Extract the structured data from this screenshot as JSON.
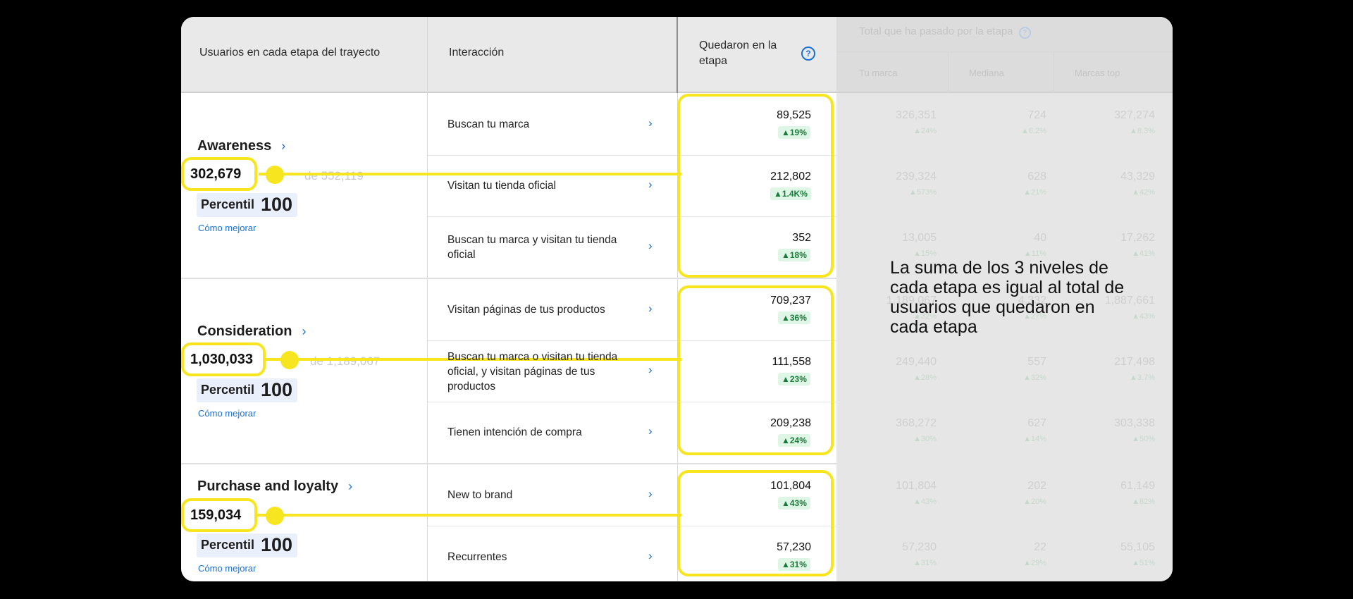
{
  "header": {
    "col1": "Usuarios en cada etapa del trayecto",
    "col2": "Interacción",
    "col3": "Quedaron en la etapa",
    "col4": "Total que ha pasado por la etapa",
    "sub_brand": "Tu marca",
    "sub_median": "Mediana",
    "sub_top": "Marcas top"
  },
  "stages": [
    {
      "name": "Awareness",
      "value": "302,679",
      "faded_share": "de 552,119",
      "percentile_label": "Percentil",
      "percentile": "100",
      "link": "Cómo mejorar"
    },
    {
      "name": "Consideration",
      "value": "1,030,033",
      "faded_share": "de 1,189,067",
      "percentile_label": "Percentil",
      "percentile": "100",
      "link": "Cómo mejorar"
    },
    {
      "name": "Purchase and loyalty",
      "value": "159,034",
      "percentile_label": "Percentil",
      "percentile": "100",
      "link": "Cómo mejorar"
    }
  ],
  "rows": [
    {
      "interaction": "Buscan tu marca",
      "stayed": "89,525",
      "stayed_pct": "▲19%",
      "brand": "326,351",
      "brand_pct": "▲24%",
      "median": "724",
      "median_pct": "▲6.2%",
      "top": "327,274",
      "top_pct": "▲8.3%"
    },
    {
      "interaction": "Visitan tu tienda oficial",
      "stayed": "212,802",
      "stayed_pct": "▲1.4K%",
      "brand": "239,324",
      "brand_pct": "▲573%",
      "median": "628",
      "median_pct": "▲21%",
      "top": "43,329",
      "top_pct": "▲42%"
    },
    {
      "interaction": "Buscan tu marca y visitan tu tienda oficial",
      "stayed": "352",
      "stayed_pct": "▲18%",
      "brand": "13,005",
      "brand_pct": "▲15%",
      "median": "40",
      "median_pct": "▲11%",
      "top": "17,262",
      "top_pct": "▲41%"
    },
    {
      "interaction": "Visitan páginas de tus productos",
      "stayed": "709,237",
      "stayed_pct": "▲36%",
      "brand": "1,189,067",
      "brand_pct": "▲32%",
      "median": "4,332",
      "median_pct": "▲27%",
      "top": "1,887,661",
      "top_pct": "▲43%"
    },
    {
      "interaction": "Buscan tu marca o visitan tu tienda oficial, y visitan páginas de tus productos",
      "stayed": "111,558",
      "stayed_pct": "▲23%",
      "brand": "249,440",
      "brand_pct": "▲28%",
      "median": "557",
      "median_pct": "▲32%",
      "top": "217,498",
      "top_pct": "▲3.7%"
    },
    {
      "interaction": "Tienen intención de compra",
      "stayed": "209,238",
      "stayed_pct": "▲24%",
      "brand": "368,272",
      "brand_pct": "▲30%",
      "median": "627",
      "median_pct": "▲14%",
      "top": "303,338",
      "top_pct": "▲50%"
    },
    {
      "interaction": "New to brand",
      "stayed": "101,804",
      "stayed_pct": "▲43%",
      "brand": "101,804",
      "brand_pct": "▲43%",
      "median": "202",
      "median_pct": "▲20%",
      "top": "61,149",
      "top_pct": "▲82%"
    },
    {
      "interaction": "Recurrentes",
      "stayed": "57,230",
      "stayed_pct": "▲31%",
      "brand": "57,230",
      "brand_pct": "▲31%",
      "median": "22",
      "median_pct": "▲29%",
      "top": "55,105",
      "top_pct": "▲51%"
    }
  ],
  "annotation": "La suma de los 3 niveles de cada etapa es igual al total de usuarios que quedaron en cada etapa",
  "icons": {
    "info": "info-icon",
    "chevron": "chevron-right-icon"
  },
  "colors": {
    "highlight": "#f7e51f",
    "link": "#1a6fd1",
    "positive": "#1a7a3a"
  }
}
